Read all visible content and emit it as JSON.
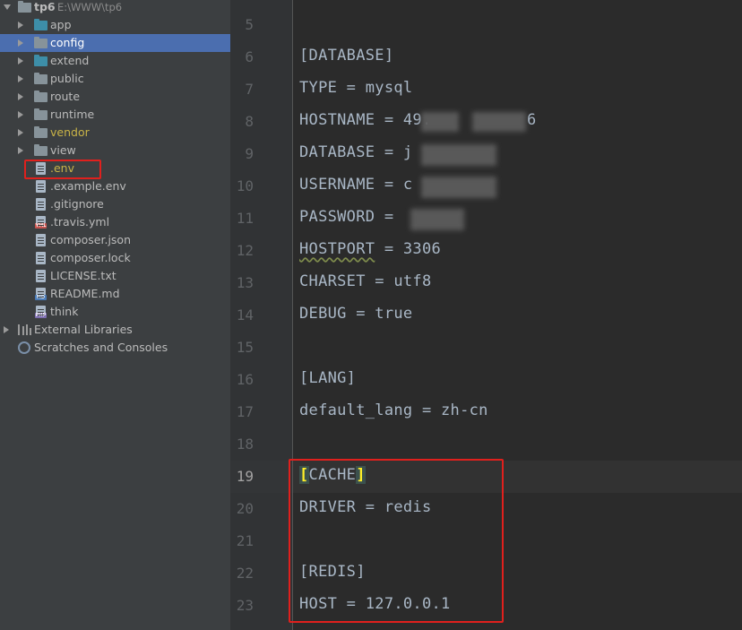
{
  "project": {
    "root_name": "tp6",
    "root_path": "E:\\WWW\\tp6",
    "items": [
      {
        "label": "app",
        "kind": "folder",
        "color": "teal"
      },
      {
        "label": "config",
        "kind": "folder",
        "color": "gray",
        "selected": true
      },
      {
        "label": "extend",
        "kind": "folder",
        "color": "teal"
      },
      {
        "label": "public",
        "kind": "folder",
        "color": "gray"
      },
      {
        "label": "route",
        "kind": "folder",
        "color": "gray"
      },
      {
        "label": "runtime",
        "kind": "folder",
        "color": "gray"
      },
      {
        "label": "vendor",
        "kind": "folder",
        "color": "gray",
        "highlight": "gold"
      },
      {
        "label": "view",
        "kind": "folder",
        "color": "gray"
      },
      {
        "label": ".env",
        "kind": "file",
        "highlight": "gold"
      },
      {
        "label": ".example.env",
        "kind": "file"
      },
      {
        "label": ".gitignore",
        "kind": "file"
      },
      {
        "label": ".travis.yml",
        "kind": "file",
        "badge": "YML"
      },
      {
        "label": "composer.json",
        "kind": "file"
      },
      {
        "label": "composer.lock",
        "kind": "file"
      },
      {
        "label": "LICENSE.txt",
        "kind": "file"
      },
      {
        "label": "README.md",
        "kind": "file",
        "badge": "MD"
      },
      {
        "label": "think",
        "kind": "file",
        "badge": "PHP"
      }
    ],
    "external_libraries": "External Libraries",
    "scratches": "Scratches and Consoles"
  },
  "editor": {
    "active_line": 19,
    "lines": [
      {
        "n": "5",
        "text": ""
      },
      {
        "n": "6",
        "text": "[DATABASE]"
      },
      {
        "n": "7",
        "text": "TYPE = mysql"
      },
      {
        "n": "8",
        "text": "HOSTNAME = 49.",
        "tail": "6"
      },
      {
        "n": "9",
        "text": "DATABASE = j"
      },
      {
        "n": "10",
        "text": "USERNAME = c"
      },
      {
        "n": "11",
        "text": "PASSWORD = "
      },
      {
        "n": "12",
        "text": "HOSTPORT = 3306"
      },
      {
        "n": "13",
        "text": "CHARSET = utf8"
      },
      {
        "n": "14",
        "text": "DEBUG = true"
      },
      {
        "n": "15",
        "text": ""
      },
      {
        "n": "16",
        "text": "[LANG]"
      },
      {
        "n": "17",
        "text": "default_lang = zh-cn"
      },
      {
        "n": "18",
        "text": ""
      },
      {
        "n": "19",
        "text": "[CACHE]"
      },
      {
        "n": "20",
        "text": "DRIVER = redis"
      },
      {
        "n": "21",
        "text": ""
      },
      {
        "n": "22",
        "text": "[REDIS]"
      },
      {
        "n": "23",
        "text": "HOST = 127.0.0.1"
      }
    ],
    "cache_section": {
      "open": "[",
      "name": "CACHE",
      "close": "]"
    },
    "hostport_key": "HOSTPORT",
    "hostport_rest": " = 3306",
    "hostname_tail": "6"
  },
  "colors": {
    "annotation_red": "#e0201d",
    "selection_blue": "#4b6eaf",
    "ignored_gold": "#c9b347"
  }
}
